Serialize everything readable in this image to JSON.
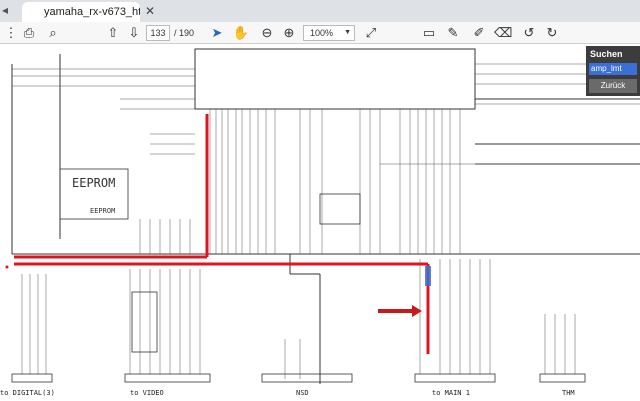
{
  "tab": {
    "title": "yamaha_rx-v673_ht..."
  },
  "toolbar": {
    "page_current": "133",
    "page_total": "/ 190",
    "zoom": "100%"
  },
  "schematic": {
    "eeprom_title": "EEPROM",
    "eeprom_sub": "EEPROM",
    "bottom_labels": [
      "to DIGITAL(3)",
      "to VIDEO",
      "NSD",
      "to MAIN 1",
      "THM"
    ]
  },
  "search": {
    "title": "Suchen",
    "value": "amp_lmt",
    "back_label": "Zurück"
  },
  "colors": {
    "highlight_red": "#e0141e",
    "selection_blue": "#3a6fd8",
    "panel_dark": "#3c3c3c"
  }
}
